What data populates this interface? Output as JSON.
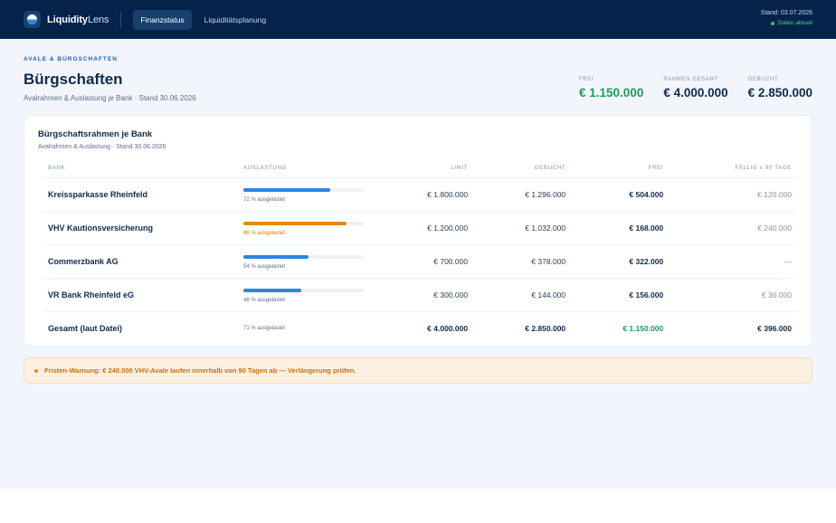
{
  "app": {
    "logo_text_a": "Liquidity",
    "logo_text_b": "Lens",
    "tabs": [
      {
        "label": "Finanzstatus",
        "active": true
      },
      {
        "label": "Liquiditätsplanung",
        "active": false
      }
    ],
    "status_date": "Stand: 03.07.2026",
    "status_live": "Daten aktuell"
  },
  "header": {
    "section_label": "AVALE & BÜRGSCHAFTEN",
    "title": "Bürgschaften",
    "subtitle": "Avalrahmen & Auslastung je Bank · Stand 30.06.2026"
  },
  "kpis": [
    {
      "label": "FREI",
      "value": "€ 1.150.000",
      "accent": "#1d9a5b"
    },
    {
      "label": "RAHMEN GESAMT",
      "value": "€ 4.000.000",
      "accent": "#0f2a4a"
    },
    {
      "label": "GEBUCHT",
      "value": "€ 2.850.000",
      "accent": "#0f2a4a"
    }
  ],
  "card": {
    "title": "Bürgschaftsrahmen je Bank",
    "subtitle": "Avalrahmen & Auslastung · Stand 30.06.2026",
    "columns": [
      "BANK",
      "AUSLASTUNG",
      "LIMIT",
      "GEBUCHT",
      "FREI",
      "FÄLLIG ≤ 90 TAGE"
    ],
    "rows": [
      {
        "bank": "Kreissparkasse Rheinfeld",
        "util_pct": 72,
        "util_text": "72 % ausgelastet",
        "warn": false,
        "limit": "€ 1.800.000",
        "booked": "€ 1.296.000",
        "free": "€ 504.000",
        "due": "€ 120.000"
      },
      {
        "bank": "VHV Kautionsversicherung",
        "util_pct": 86,
        "util_text": "86 % ausgelastet",
        "warn": true,
        "limit": "€ 1.200.000",
        "booked": "€ 1.032.000",
        "free": "€ 168.000",
        "due": "€ 240.000"
      },
      {
        "bank": "Commerzbank AG",
        "util_pct": 54,
        "util_text": "54 % ausgelastet",
        "warn": false,
        "limit": "€ 700.000",
        "booked": "€ 378.000",
        "free": "€ 322.000",
        "due": "—"
      },
      {
        "bank": "VR Bank Rheinfeld eG",
        "util_pct": 48,
        "util_text": "48 % ausgelastet",
        "warn": false,
        "limit": "€ 300.000",
        "booked": "€ 144.000",
        "free": "€ 156.000",
        "due": "€ 36.000"
      }
    ],
    "total": {
      "bank": "Gesamt (laut Datei)",
      "util_text": "71 % ausgelastet",
      "limit": "€ 4.000.000",
      "booked": "€ 2.850.000",
      "free": "€ 1.150.000",
      "due": "€ 396.000"
    }
  },
  "warning": {
    "text": "Fristen-Warnung: € 240.000 VHV-Avale laufen innerhalb von 90 Tagen ab — Verlängerung prüfen."
  }
}
